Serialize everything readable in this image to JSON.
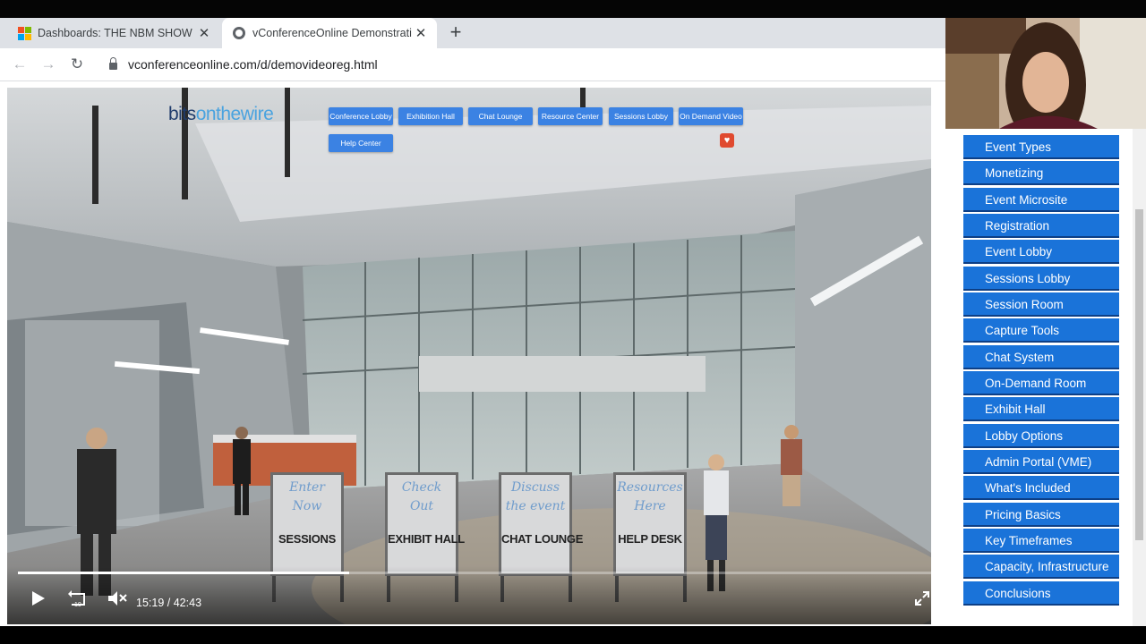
{
  "browser": {
    "tabs": [
      {
        "title": "Dashboards: THE NBM SHOW - M",
        "icon": "microsoft-icon",
        "active": false
      },
      {
        "title": "vConferenceOnline Demonstratio",
        "icon": "globe-icon",
        "active": true
      }
    ],
    "url": "vconferenceonline.com/d/demovideoreg.html"
  },
  "video": {
    "logo_part1": "bits",
    "logo_part2": "onthewire",
    "nav_buttons": [
      "Conference Lobby",
      "Exhibition Hall",
      "Chat Lounge",
      "Resource Center",
      "Sessions Lobby",
      "On Demand Video",
      "Help Center"
    ],
    "signs": [
      {
        "handwriting": "Enter\nNow",
        "label": "SESSIONS"
      },
      {
        "handwriting": "Check\nOut",
        "label": "EXHIBIT HALL"
      },
      {
        "handwriting": "Discuss\nthe event",
        "label": "CHAT LOUNGE"
      },
      {
        "handwriting": "Resources\nHere",
        "label": "HELP DESK"
      }
    ],
    "current_time": "15:19",
    "separator": "/",
    "duration": "42:43",
    "progress_fraction": 0.358
  },
  "sidebar": {
    "items": [
      "Event Types",
      "Monetizing",
      "Event Microsite",
      "Registration",
      "Event Lobby",
      "Sessions Lobby",
      "Session Room",
      "Capture Tools",
      "Chat System",
      "On-Demand Room",
      "Exhibit Hall",
      "Lobby Options",
      "Admin Portal (VME)",
      "What's Included",
      "Pricing Basics",
      "Key Timeframes",
      "Capacity, Infrastructure",
      "Conclusions"
    ]
  },
  "colors": {
    "menu_blue": "#1a73d9",
    "nav_blue": "#3b82e3",
    "tabbar": "#dee1e6"
  }
}
